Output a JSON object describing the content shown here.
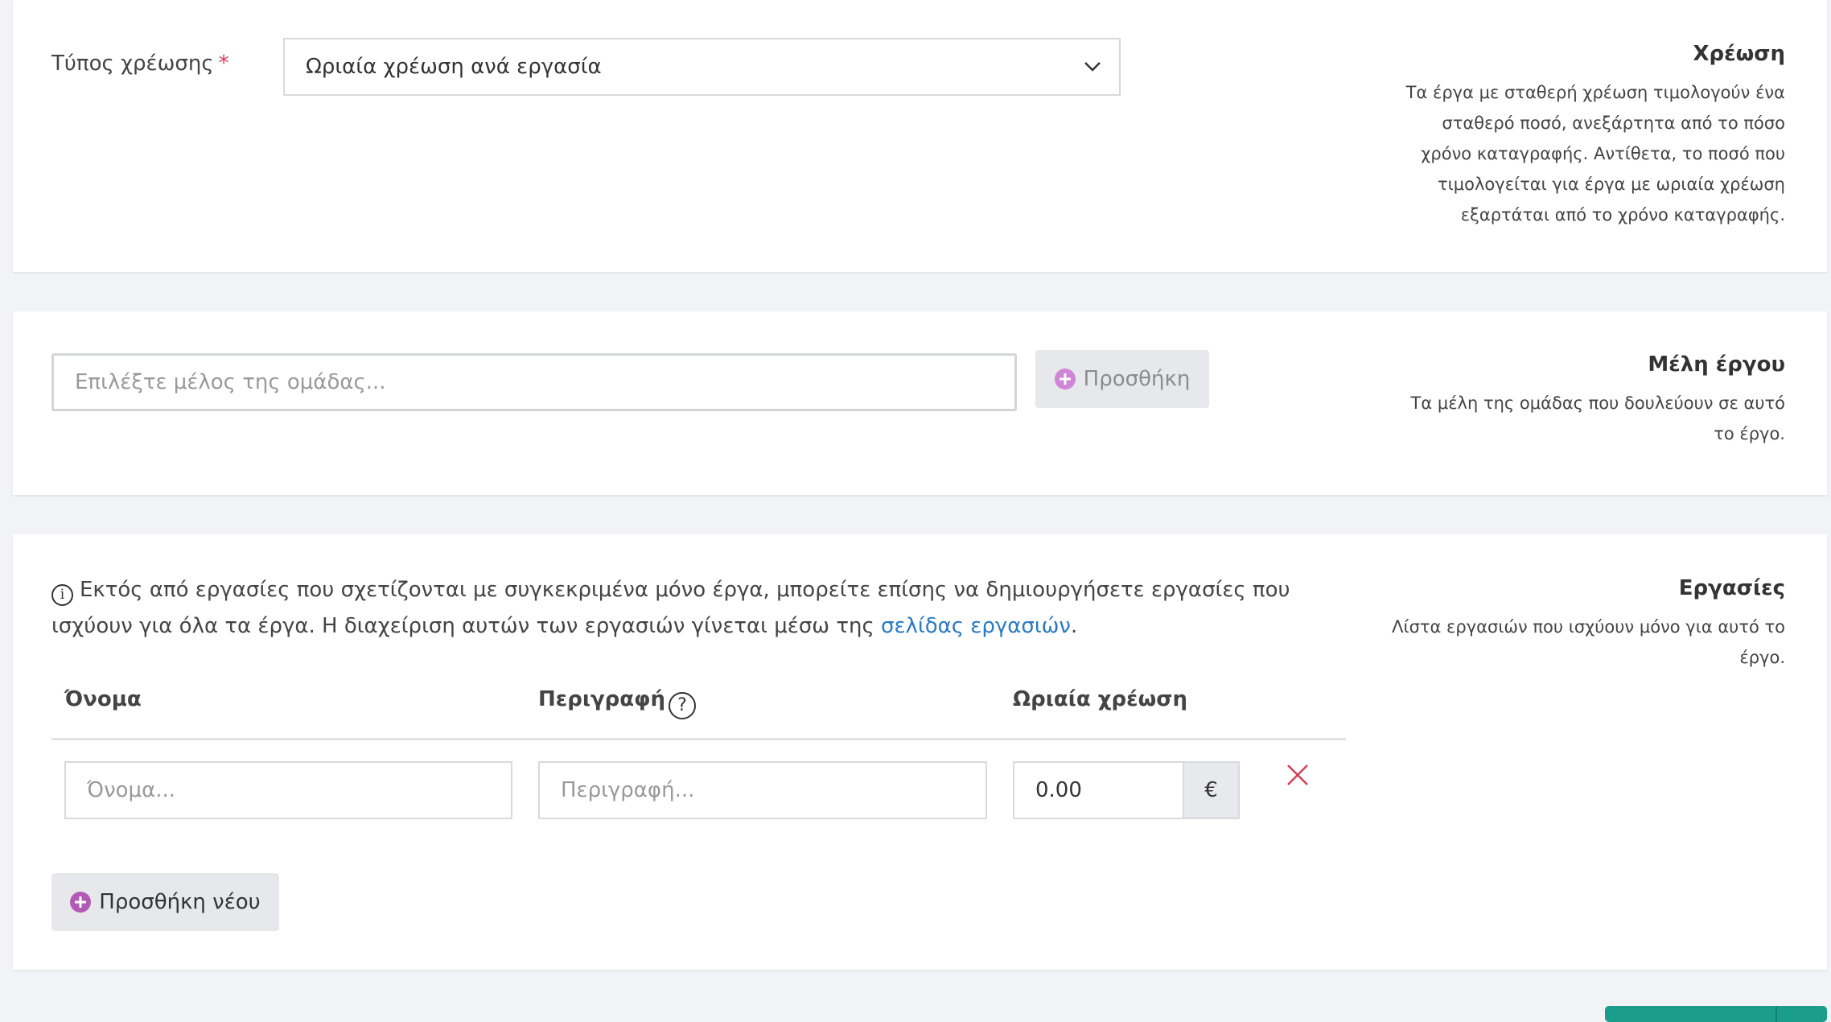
{
  "billing": {
    "label": "Τύπος χρέωσης",
    "required_mark": "*",
    "selected": "Ωριαία χρέωση ανά εργασία",
    "side_title": "Χρέωση",
    "side_desc_lines": [
      "Τα έργα με σταθερή χρέωση τιμολογούν ένα",
      "σταθερό ποσό, ανεξάρτητα από το πόσο",
      "χρόνο καταγραφής. Αντίθετα, το ποσό που",
      "τιμολογείται για έργα με ωριαία χρέωση",
      "εξαρτάται από το χρόνο καταγραφής."
    ]
  },
  "members": {
    "placeholder": "Επιλέξτε μέλος της ομάδας...",
    "add_label": "Προσθήκη",
    "side_title": "Μέλη έργου",
    "side_desc_lines": [
      "Τα μέλη της ομάδας που δουλεύουν σε αυτό",
      "το έργο."
    ]
  },
  "tasks": {
    "info_text": "Εκτός από εργασίες που σχετίζονται με συγκεκριμένα μόνο έργα, μπορείτε επίσης να δημιουργήσετε εργασίες που ισχύουν για όλα τα έργα. Η διαχείριση αυτών των εργασιών γίνεται μέσω της ",
    "info_link": "σελίδας εργασιών",
    "info_end": ".",
    "columns": {
      "name": "Όνομα",
      "description": "Περιγραφή",
      "hourly": "Ωριαία χρέωση"
    },
    "row": {
      "name_placeholder": "Όνομα...",
      "description_placeholder": "Περιγραφή...",
      "rate_value": "0.00",
      "currency": "€"
    },
    "add_new_label": "Προσθήκη νέου",
    "side_title": "Εργασίες",
    "side_desc_lines": [
      "Λίστα εργασιών που ισχύουν μόνο για αυτό το",
      "έργο."
    ]
  },
  "colors": {
    "accent_purple": "#b25ab6",
    "link_blue": "#2b79c2",
    "remove_red": "#d23f57",
    "save_green": "#1a9e8b"
  }
}
